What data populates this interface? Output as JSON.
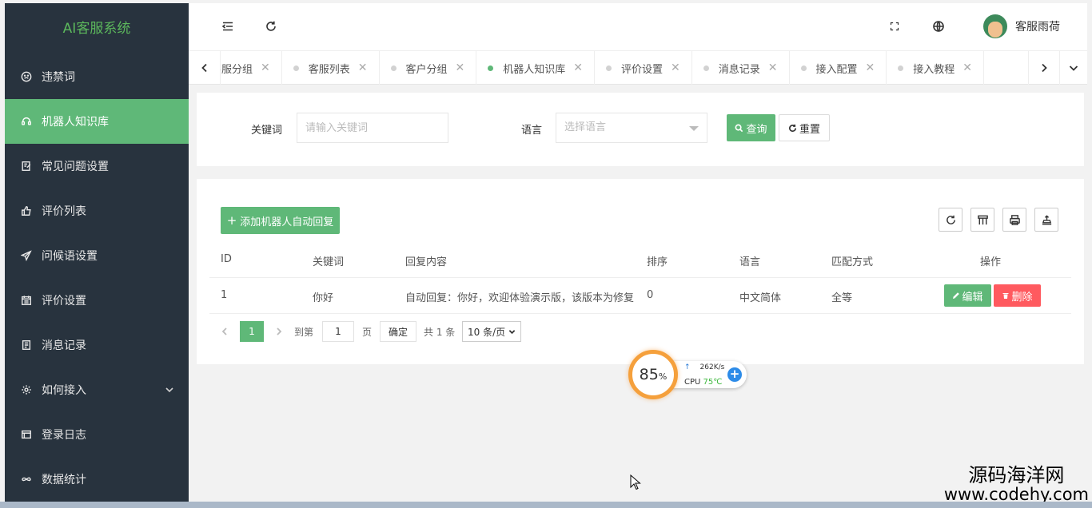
{
  "sidebar": {
    "logo": "AI客服系统",
    "items": [
      {
        "label": "违禁词",
        "icon": "smile-icon"
      },
      {
        "label": "机器人知识库",
        "icon": "headset-icon",
        "active": true
      },
      {
        "label": "常见问题设置",
        "icon": "edit-icon"
      },
      {
        "label": "评价列表",
        "icon": "thumbs-up-icon"
      },
      {
        "label": "问候语设置",
        "icon": "send-icon"
      },
      {
        "label": "评价设置",
        "icon": "calendar-icon"
      },
      {
        "label": "消息记录",
        "icon": "note-icon"
      },
      {
        "label": "如何接入",
        "icon": "gear-icon",
        "has_children": true
      },
      {
        "label": "登录日志",
        "icon": "window-icon"
      },
      {
        "label": "数据统计",
        "icon": "infinity-icon"
      }
    ]
  },
  "header": {
    "user_name": "客服雨荷"
  },
  "tabs": [
    {
      "label": "客服分组"
    },
    {
      "label": "客服列表"
    },
    {
      "label": "客户分组"
    },
    {
      "label": "机器人知识库",
      "active": true
    },
    {
      "label": "评价设置"
    },
    {
      "label": "消息记录"
    },
    {
      "label": "接入配置"
    },
    {
      "label": "接入教程"
    }
  ],
  "search": {
    "keyword_label": "关键词",
    "keyword_placeholder": "请输入关键词",
    "language_label": "语言",
    "language_placeholder": "选择语言",
    "query_label": "查询",
    "reset_label": "重置"
  },
  "table": {
    "add_label": "添加机器人自动回复",
    "columns": [
      "ID",
      "关键词",
      "回复内容",
      "排序",
      "语言",
      "匹配方式",
      "操作"
    ],
    "rows": [
      {
        "id": "1",
        "keyword": "你好",
        "content": "自动回复：你好，欢迎体验演示版，该版本为修复",
        "sort": "0",
        "language": "中文简体",
        "match": "全等"
      }
    ],
    "edit_label": "编辑",
    "delete_label": "删除"
  },
  "pager": {
    "current": "1",
    "goto_label": "到第",
    "goto_value": "1",
    "page_label": "页",
    "confirm_label": "确定",
    "total_label": "共 1 条",
    "page_size": "10 条/页"
  },
  "monitor": {
    "percent": "85",
    "percent_unit": "%",
    "net_speed": "262K/s",
    "cpu_label": "CPU",
    "cpu_temp": "75℃"
  },
  "watermark": {
    "line1": "源码海洋网",
    "line2": "www.codehy.com"
  },
  "colors": {
    "sidebar_bg": "#28333e",
    "accent_green": "#5fb878",
    "danger_red": "#ff5a5f",
    "monitor_orange": "#f5a03c"
  }
}
